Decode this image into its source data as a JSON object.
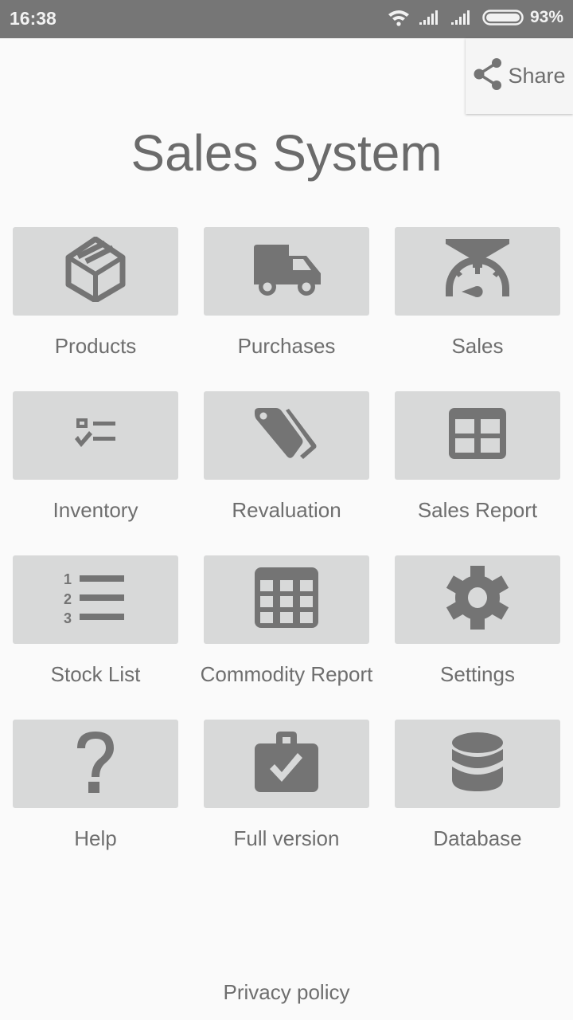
{
  "status_bar": {
    "time": "16:38",
    "battery_percent": "93%",
    "icons": [
      "wifi-icon",
      "signal-icon",
      "signal-icon",
      "battery-icon"
    ]
  },
  "share": {
    "label": "Share",
    "icon": "share-icon"
  },
  "app_title": "Sales System",
  "tiles": [
    {
      "label": "Products",
      "icon": "box-icon"
    },
    {
      "label": "Purchases",
      "icon": "truck-icon"
    },
    {
      "label": "Sales",
      "icon": "scale-icon"
    },
    {
      "label": "Inventory",
      "icon": "checklist-icon"
    },
    {
      "label": "Revaluation",
      "icon": "tags-icon"
    },
    {
      "label": "Sales Report",
      "icon": "table-icon"
    },
    {
      "label": "Stock List",
      "icon": "numbered-list-icon"
    },
    {
      "label": "Commodity Report",
      "icon": "calculator-grid-icon"
    },
    {
      "label": "Settings",
      "icon": "gear-icon"
    },
    {
      "label": "Help",
      "icon": "question-icon"
    },
    {
      "label": "Full version",
      "icon": "briefcase-check-icon"
    },
    {
      "label": "Database",
      "icon": "database-icon"
    }
  ],
  "footer": {
    "privacy_label": "Privacy policy"
  },
  "colors": {
    "tile_bg": "#d8d9d9",
    "icon": "#747474",
    "background": "#fafafa",
    "status_bar": "#767676"
  }
}
